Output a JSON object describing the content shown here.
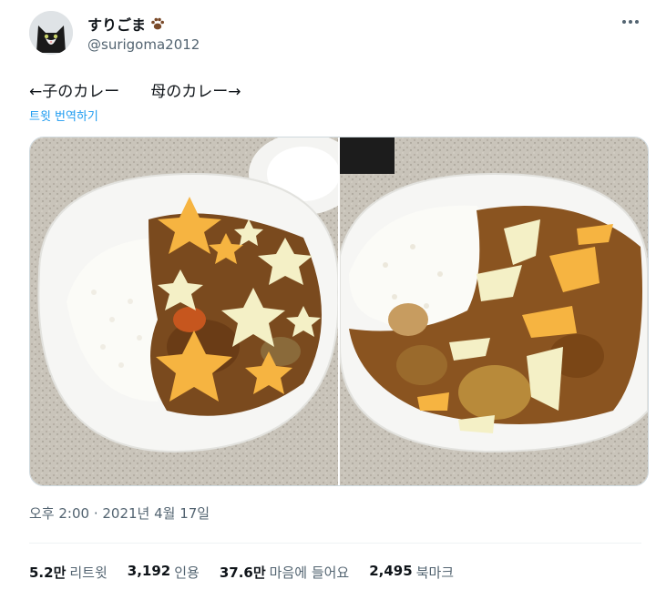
{
  "author": {
    "display_name": "すりごま",
    "handle": "@surigoma2012",
    "name_emoji_icon": "paw-print-icon",
    "avatar_icon": "cat-avatar-icon"
  },
  "menu_icon": "more-horizontal-icon",
  "tweet": {
    "text": "←子のカレー　　母のカレー→",
    "translate_link": "트윗 번역하기"
  },
  "media": {
    "left_photo": "kids-curry-with-star-shaped-cheese",
    "right_photo": "moms-curry-with-torn-cheese"
  },
  "timestamp": "오후 2:00 · 2021년 4월 17일",
  "stats": [
    {
      "value": "5.2만",
      "label": "리트윗"
    },
    {
      "value": "3,192",
      "label": "인용"
    },
    {
      "value": "37.6만",
      "label": "마음에 들어요"
    },
    {
      "value": "2,495",
      "label": "북마크"
    }
  ],
  "colors": {
    "link": "#1d9bf0",
    "secondary_text": "#536471",
    "primary_text": "#0f1419",
    "divider": "#eff3f4"
  }
}
